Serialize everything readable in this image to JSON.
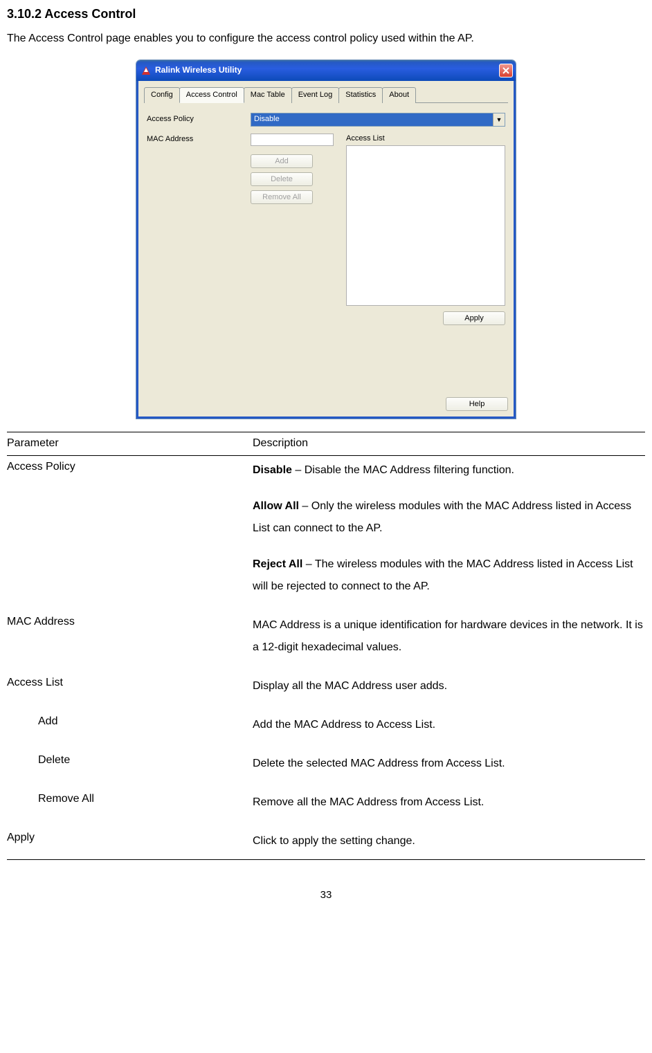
{
  "heading": "3.10.2 Access Control",
  "intro": "The Access Control page enables you to configure the access control policy used within the AP.",
  "window": {
    "title": "Ralink Wireless Utility",
    "close": "X",
    "tabs": {
      "config": "Config",
      "access_control": "Access Control",
      "mac_table": "Mac Table",
      "event_log": "Event Log",
      "statistics": "Statistics",
      "about": "About"
    },
    "labels": {
      "access_policy": "Access Policy",
      "mac_address": "MAC Address",
      "access_list": "Access List"
    },
    "dropdown_value": "Disable",
    "buttons": {
      "add": "Add",
      "delete": "Delete",
      "remove_all": "Remove All",
      "apply": "Apply",
      "help": "Help"
    }
  },
  "table": {
    "header_param": "Parameter",
    "header_desc": "Description",
    "rows": {
      "access_policy": {
        "param": "Access Policy",
        "disable_bold": "Disable",
        "disable_rest": " – Disable the MAC Address filtering function.",
        "allow_bold": "Allow All",
        "allow_rest": " – Only the wireless modules with the MAC Address listed in Access List can connect to the AP.",
        "reject_bold": "Reject All",
        "reject_rest": " – The wireless modules with the MAC Address listed in Access List will be rejected to connect to the AP."
      },
      "mac_address": {
        "param": "MAC Address",
        "desc": "MAC Address is a unique identification for hardware devices in the network. It is a 12-digit hexadecimal values."
      },
      "access_list": {
        "param": "Access List",
        "desc": "Display all the MAC Address user adds."
      },
      "add": {
        "param": "Add",
        "desc": "Add the MAC Address to Access List."
      },
      "delete": {
        "param": "Delete",
        "desc": "Delete the selected MAC Address from Access List."
      },
      "remove_all": {
        "param": "Remove All",
        "desc": "Remove all the MAC Address from Access List."
      },
      "apply": {
        "param": "Apply",
        "desc": "Click to apply the setting change."
      }
    }
  },
  "page_number": "33"
}
